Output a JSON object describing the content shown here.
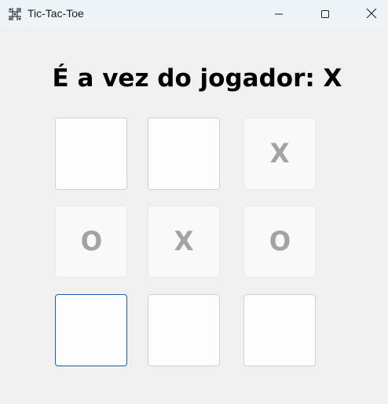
{
  "window": {
    "title": "Tic-Tac-Toe",
    "icon": "tic-tac-toe-grid-icon",
    "controls": [
      "minimize-icon",
      "maximize-icon",
      "close-icon"
    ]
  },
  "game": {
    "turn_text": "É a vez do jogador: X",
    "board": [
      [
        "",
        "",
        "X"
      ],
      [
        "O",
        "X",
        "O"
      ],
      [
        "",
        "",
        ""
      ]
    ],
    "focused_cell": [
      2,
      0
    ]
  },
  "colors": {
    "background": "#f0f0f0",
    "titlebar": "#eef3f8",
    "mark": "#a3a3a3",
    "focus_border": "#1a5fa8"
  }
}
